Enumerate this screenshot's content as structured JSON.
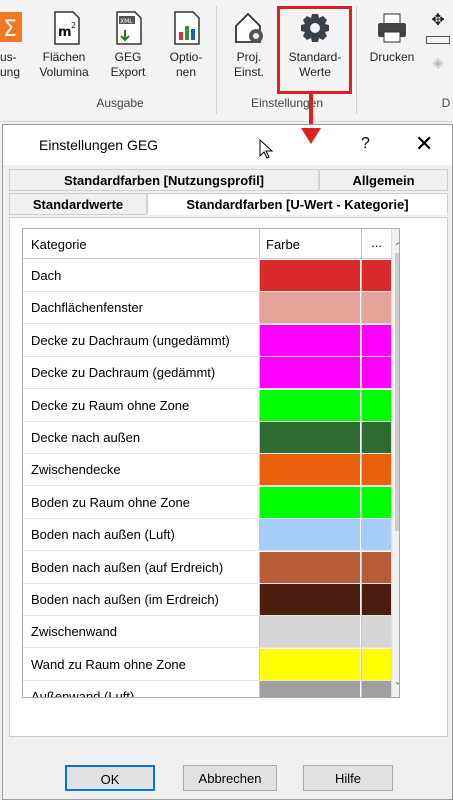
{
  "ribbon": {
    "buttons": [
      {
        "label": "us-\nung",
        "icon": "sigma-icon"
      },
      {
        "label": "Flächen\nVolumina",
        "icon": "area-m2-icon"
      },
      {
        "label": "GEG\nExport",
        "icon": "xml-export-icon"
      },
      {
        "label": "Optio-\nnen",
        "icon": "chart-options-icon"
      },
      {
        "label": "Proj.\nEinst.",
        "icon": "house-gear-icon"
      },
      {
        "label": "Standard-\nWerte",
        "icon": "gear-icon"
      },
      {
        "label": "Drucken",
        "icon": "printer-icon"
      }
    ],
    "groups": {
      "ausgabe": "Ausgabe",
      "einstellungen": "Einstellungen",
      "right": "D"
    },
    "highlight_color": "#e02020"
  },
  "dialog": {
    "title": "Einstellungen GEG",
    "help": "?",
    "close": "✕",
    "tabs_back": [
      "Standardfarben [Nutzungsprofil]",
      "Allgemein"
    ],
    "tabs_front": [
      "Standardwerte",
      "Standardfarben [U-Wert - Kategorie]"
    ],
    "active_tab": "Standardfarben [U-Wert - Kategorie]",
    "grid": {
      "headers": [
        "Kategorie",
        "Farbe",
        "..."
      ],
      "rows": [
        {
          "name": "Dach",
          "color": "#d92b2b"
        },
        {
          "name": "Dachflächenfenster",
          "color": "#e4a399"
        },
        {
          "name": "Decke zu Dachraum (ungedämmt)",
          "color": "#ff00ff"
        },
        {
          "name": "Decke zu Dachraum (gedämmt)",
          "color": "#ff00ff"
        },
        {
          "name": "Decke zu Raum ohne Zone",
          "color": "#00ff00"
        },
        {
          "name": "Decke nach außen",
          "color": "#2e6b2e"
        },
        {
          "name": "Zwischendecke",
          "color": "#e85f0c"
        },
        {
          "name": "Boden zu Raum ohne Zone",
          "color": "#00ff00"
        },
        {
          "name": "Boden nach außen (Luft)",
          "color": "#a6cdf7"
        },
        {
          "name": "Boden nach außen (auf Erdreich)",
          "color": "#b85c38"
        },
        {
          "name": "Boden nach außen (im Erdreich)",
          "color": "#4a1d0f"
        },
        {
          "name": "Zwischenwand",
          "color": "#d6d6d6"
        },
        {
          "name": "Wand zu Raum ohne Zone",
          "color": "#ffff00"
        },
        {
          "name": "Außenwand (Luft)",
          "color": "#a0a0a0"
        }
      ]
    },
    "buttons": {
      "ok": "OK",
      "cancel": "Abbrechen",
      "help": "Hilfe"
    }
  }
}
